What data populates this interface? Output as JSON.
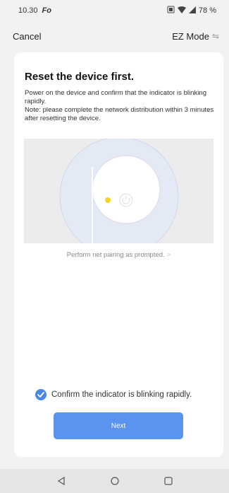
{
  "status_bar": {
    "time": "10.30",
    "app_indicator": "Fo",
    "battery": "78 %",
    "icons": [
      "sim-icon",
      "wifi-icon",
      "signal-icon"
    ]
  },
  "nav": {
    "cancel_label": "Cancel",
    "mode_label": "EZ Mode",
    "mode_icon": "swap-icon"
  },
  "card": {
    "title": "Reset the device first.",
    "description_line1": "Power on the device and confirm that the indicator is blinking rapidly.",
    "description_line2": "Note: please complete the network distribution within 3 minutes after resetting the device.",
    "prompt_link": "Perform net pairing as prompted.",
    "confirm_label": "Confirm the indicator is blinking rapidly.",
    "confirm_checked": true,
    "next_label": "Next"
  },
  "colors": {
    "accent": "#5b93f0",
    "check": "#4a86e8",
    "indicator_led": "#f5d328",
    "illustration_bg": "#ececec",
    "device_bg": "#e9eef8"
  },
  "system_nav": {
    "icons": [
      "back-icon",
      "home-icon",
      "recents-icon"
    ]
  }
}
